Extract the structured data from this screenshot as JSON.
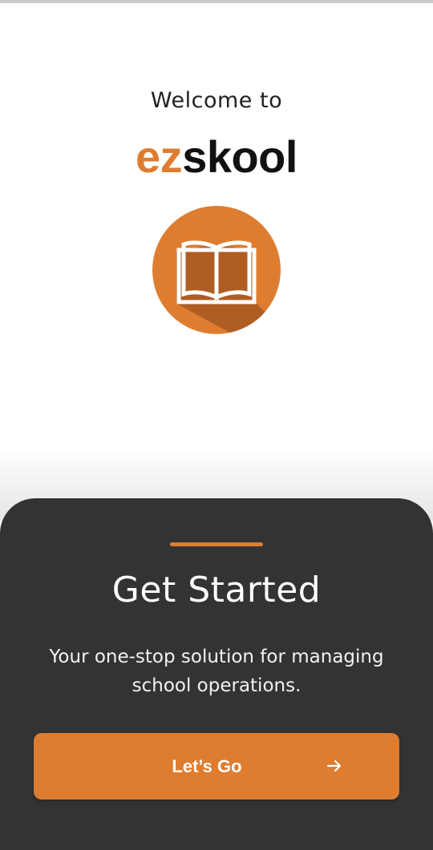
{
  "welcome": {
    "prefix": "Welcome to"
  },
  "brand": {
    "accent": "ez",
    "rest": "skool"
  },
  "logo": {
    "icon": "open-book-icon"
  },
  "sheet": {
    "title": "Get Started",
    "description": "Your one-stop solution for managing school operations.",
    "cta_label": "Let’s Go",
    "cta_icon": "arrow-right-icon"
  },
  "colors": {
    "accent": "#de7d30",
    "sheet_background": "#333333",
    "logo_shadow": "#a95b22"
  }
}
